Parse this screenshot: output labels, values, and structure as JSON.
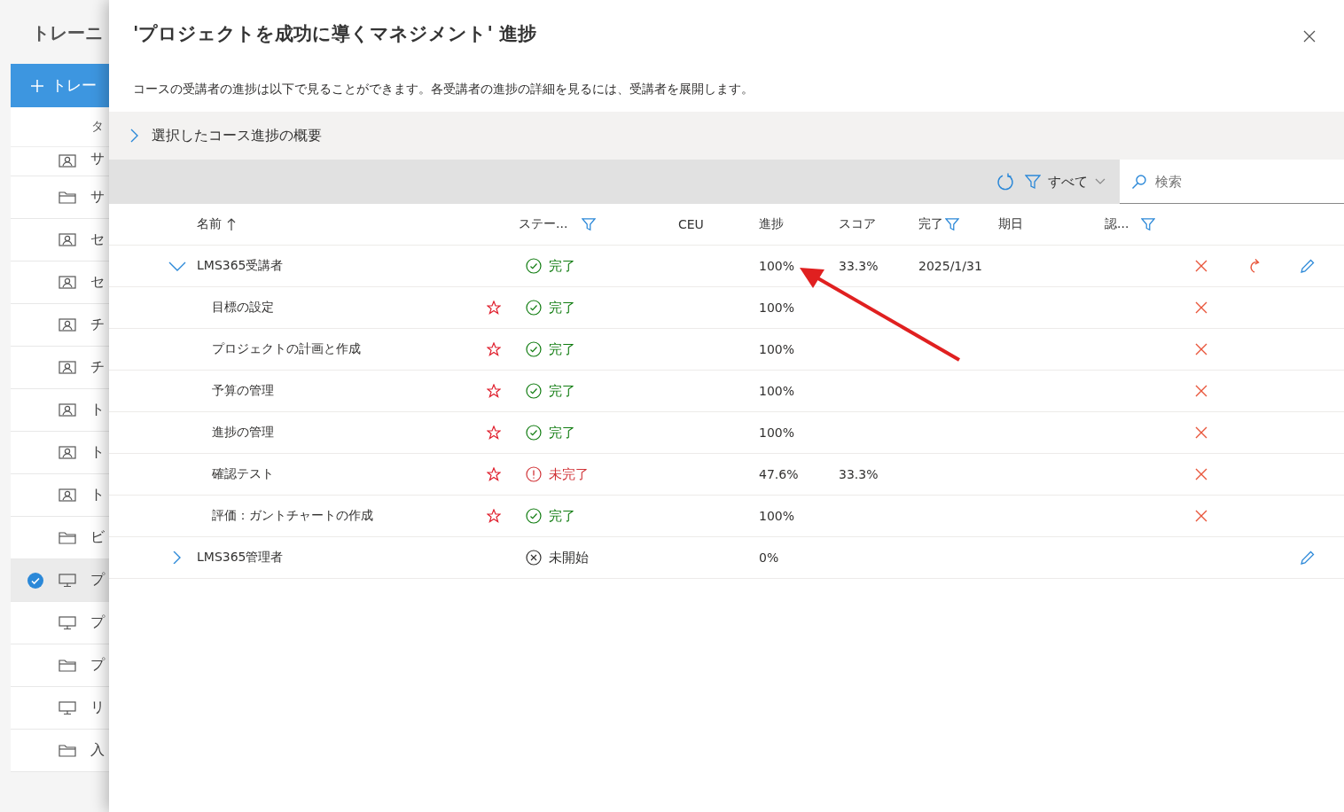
{
  "background_page": {
    "title": "トレーニ",
    "new_button": {
      "label": "トレー"
    },
    "column_header": "タ",
    "items": [
      {
        "kind": "person",
        "label": "サ",
        "selected": false
      },
      {
        "kind": "folder",
        "label": "サ",
        "selected": false
      },
      {
        "kind": "person",
        "label": "セ",
        "selected": false
      },
      {
        "kind": "person",
        "label": "セ",
        "selected": false
      },
      {
        "kind": "person",
        "label": "チ",
        "selected": false
      },
      {
        "kind": "person",
        "label": "チ",
        "selected": false
      },
      {
        "kind": "person",
        "label": "ト",
        "selected": false
      },
      {
        "kind": "person",
        "label": "ト",
        "selected": false
      },
      {
        "kind": "person",
        "label": "ト",
        "selected": false
      },
      {
        "kind": "folder",
        "label": "ビ",
        "selected": false
      },
      {
        "kind": "monitor",
        "label": "プ",
        "selected": true
      },
      {
        "kind": "monitor",
        "label": "プ",
        "selected": false
      },
      {
        "kind": "folder",
        "label": "プ",
        "selected": false
      },
      {
        "kind": "monitor",
        "label": "リ",
        "selected": false
      },
      {
        "kind": "folder",
        "label": "入",
        "selected": false
      }
    ]
  },
  "dialog": {
    "title": "'プロジェクトを成功に導くマネジメント' 進捗",
    "description": "コースの受講者の進捗は以下で見ることができます。各受講者の進捗の詳細を見るには、受講者を展開します。",
    "summary": {
      "label": "選択したコース進捗の概要",
      "expanded": false
    },
    "toolbar": {
      "filter_label": "すべて",
      "search_placeholder": "検索"
    },
    "columns": [
      {
        "label": "名前",
        "sorted": true,
        "filter": false
      },
      {
        "label": "ステー...",
        "sorted": false,
        "filter": true
      },
      {
        "label": "CEU",
        "sorted": false,
        "filter": false
      },
      {
        "label": "進捗",
        "sorted": false,
        "filter": false
      },
      {
        "label": "スコア",
        "sorted": false,
        "filter": false
      },
      {
        "label": "完了",
        "sorted": false,
        "filter": true
      },
      {
        "label": "期日",
        "sorted": false,
        "filter": false
      },
      {
        "label": "認...",
        "sorted": false,
        "filter": true
      }
    ],
    "rows": [
      {
        "name": "LMS365受講者",
        "expanded": true,
        "status": {
          "kind": "complete",
          "label": "完了"
        },
        "progress": "100%",
        "score": "33.3%",
        "completed": "2025/1/31",
        "actions": [
          {
            "kind": "delete"
          },
          {
            "kind": "reset"
          },
          {
            "kind": "edit"
          }
        ],
        "children": [
          {
            "name": "目標の設定",
            "starred": true,
            "status": {
              "kind": "complete",
              "label": "完了"
            },
            "progress": "100%",
            "actions": [
              {
                "kind": "delete"
              }
            ]
          },
          {
            "name": "プロジェクトの計画と作成",
            "starred": true,
            "status": {
              "kind": "complete",
              "label": "完了"
            },
            "progress": "100%",
            "actions": [
              {
                "kind": "delete"
              }
            ]
          },
          {
            "name": "予算の管理",
            "starred": true,
            "status": {
              "kind": "complete",
              "label": "完了"
            },
            "progress": "100%",
            "actions": [
              {
                "kind": "delete"
              }
            ]
          },
          {
            "name": "進捗の管理",
            "starred": true,
            "status": {
              "kind": "complete",
              "label": "完了"
            },
            "progress": "100%",
            "actions": [
              {
                "kind": "delete"
              }
            ]
          },
          {
            "name": "確認テスト",
            "starred": true,
            "status": {
              "kind": "incomplete",
              "label": "未完了"
            },
            "progress": "47.6%",
            "score": "33.3%",
            "actions": [
              {
                "kind": "delete"
              }
            ]
          },
          {
            "name": "評価：ガントチャートの作成",
            "starred": true,
            "status": {
              "kind": "complete",
              "label": "完了"
            },
            "progress": "100%",
            "actions": [
              {
                "kind": "delete"
              }
            ]
          }
        ]
      },
      {
        "name": "LMS365管理者",
        "expanded": false,
        "status": {
          "kind": "not_started",
          "label": "未開始"
        },
        "progress": "0%",
        "actions": [
          {
            "kind": "edit"
          }
        ],
        "children": []
      }
    ]
  }
}
